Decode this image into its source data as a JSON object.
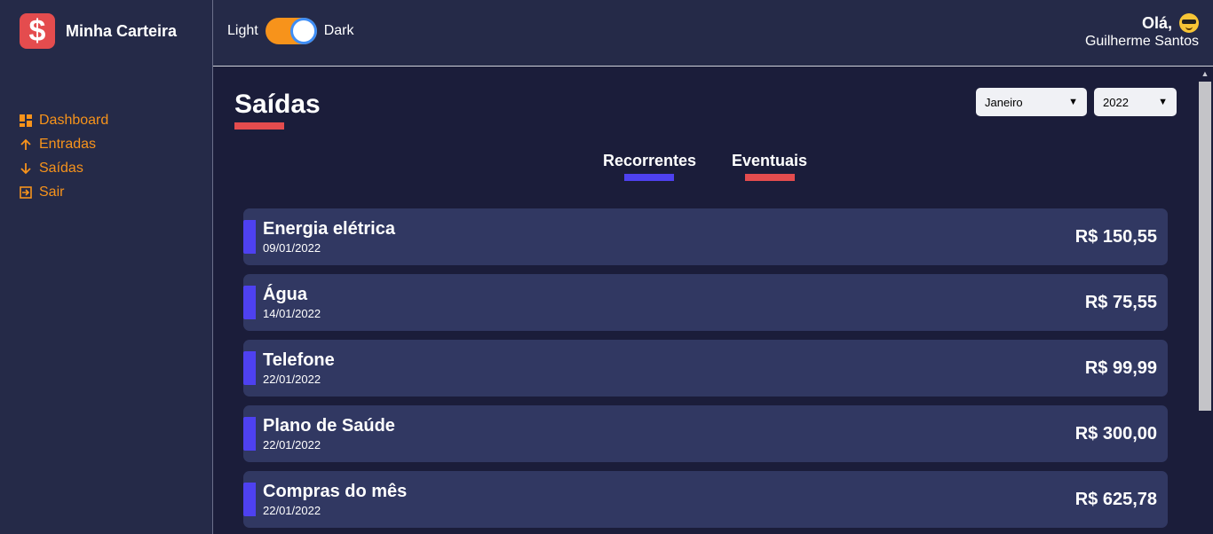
{
  "brand": {
    "logo_symbol": "$",
    "name": "Minha Carteira"
  },
  "menu": [
    {
      "icon": "dashboard-icon",
      "label": "Dashboard"
    },
    {
      "icon": "arrow-up-icon",
      "label": "Entradas"
    },
    {
      "icon": "arrow-down-icon",
      "label": "Saídas"
    },
    {
      "icon": "exit-icon",
      "label": "Sair"
    }
  ],
  "header": {
    "theme_light_label": "Light",
    "theme_dark_label": "Dark",
    "greeting": "Olá,",
    "greeting_icon": "sunglasses-emoji-icon",
    "user_name": "Guilherme Santos"
  },
  "page": {
    "title": "Saídas",
    "month": "Janeiro",
    "year": "2022"
  },
  "tabs": [
    {
      "label": "Recorrentes",
      "color": "#4e41f0"
    },
    {
      "label": "Eventuais",
      "color": "#e44c4e"
    }
  ],
  "items": [
    {
      "description": "Energia elétrica",
      "date": "09/01/2022",
      "amount": "R$ 150,55"
    },
    {
      "description": "Água",
      "date": "14/01/2022",
      "amount": "R$ 75,55"
    },
    {
      "description": "Telefone",
      "date": "22/01/2022",
      "amount": "R$ 99,99"
    },
    {
      "description": "Plano de Saúde",
      "date": "22/01/2022",
      "amount": "R$ 300,00"
    },
    {
      "description": "Compras do mês",
      "date": "22/01/2022",
      "amount": "R$ 625,78"
    }
  ],
  "colors": {
    "accent_orange": "#f7931b",
    "red": "#e44c4e",
    "recurring_blue": "#4e41f0",
    "card_bg": "#313862",
    "sidebar_bg": "#252a48",
    "content_bg": "#1b1d3a"
  }
}
